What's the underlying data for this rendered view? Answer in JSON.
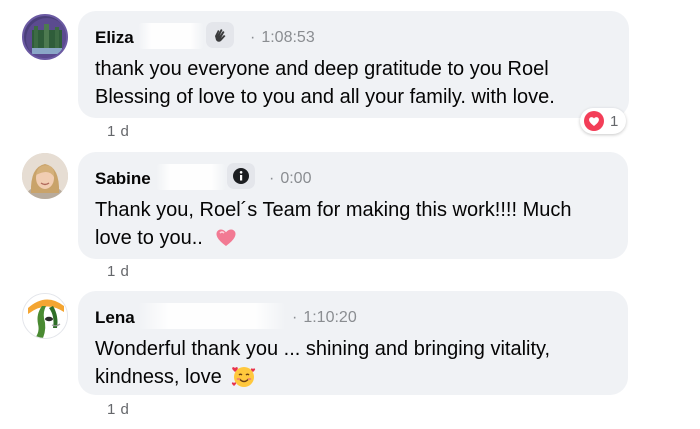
{
  "comments": [
    {
      "author": "Eliza",
      "timestamp": "1:08:53",
      "badge_icon": "clap-hands-icon",
      "text_line1": "thank you everyone and deep gratitude to you Roel",
      "text_line2": "Blessing of love to you and all your family. with love.",
      "age": "1 d",
      "reaction": {
        "icon": "love-heart-icon",
        "count": "1"
      }
    },
    {
      "author": "Sabine",
      "timestamp": "0:00",
      "badge_icon": "info-icon",
      "text_line1": "Thank you, Roel´s Team for making this work!!!! Much",
      "text_line2": "love to you..",
      "emoji": "heart-emoji",
      "age": "1 d"
    },
    {
      "author": "Lena",
      "timestamp": "1:10:20",
      "text_line1": "Wonderful thank you ... shining and bringing vitality,",
      "text_line2": "kindness, love",
      "emoji": "smiling-face-with-hearts-emoji",
      "age": "1 d"
    }
  ],
  "colors": {
    "bubble": "#f0f2f5",
    "timestamp": "#8a8d91",
    "reaction_red": "#f33e58"
  }
}
